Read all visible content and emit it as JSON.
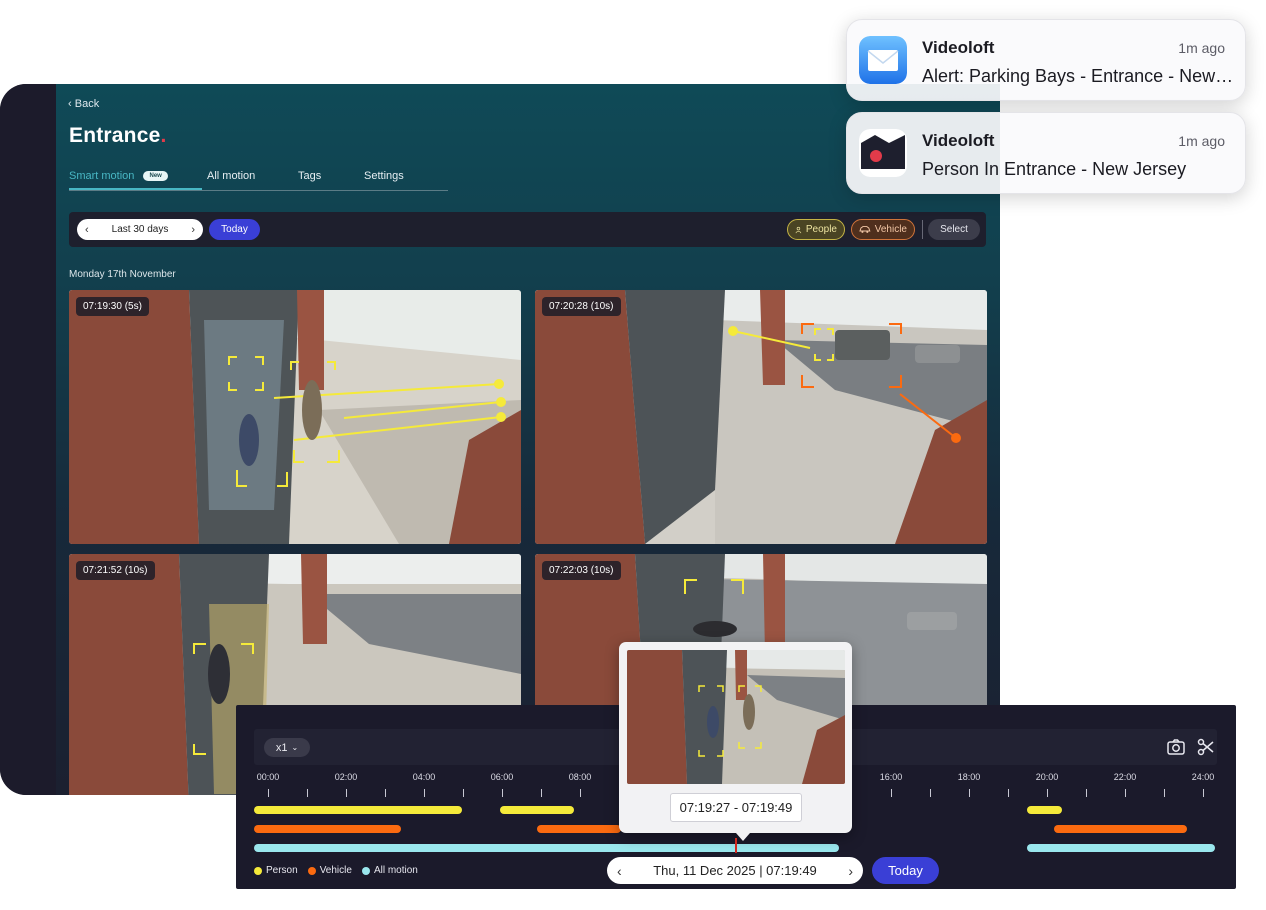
{
  "page": {
    "back_label": "Back",
    "title": "Entrance",
    "title_dot": "."
  },
  "tabs": [
    {
      "label": "Smart motion",
      "badge": "New",
      "active": true
    },
    {
      "label": "All motion"
    },
    {
      "label": "Tags"
    },
    {
      "label": "Settings"
    }
  ],
  "filters": {
    "range_label": "Last 30 days",
    "today_label": "Today",
    "people_label": "People",
    "vehicle_label": "Vehicle",
    "select_label": "Select"
  },
  "date_heading": "Monday 17th November",
  "clips": [
    {
      "timestamp": "07:19:30 (5s)"
    },
    {
      "timestamp": "07:20:28 (10s)"
    },
    {
      "timestamp": "07:21:52 (10s)"
    },
    {
      "timestamp": "07:22:03 (10s)"
    }
  ],
  "notifications": [
    {
      "app": "Videoloft",
      "time": "1m ago",
      "message": "Alert: Parking Bays - Entrance - New Jersey",
      "icon": "mail-icon"
    },
    {
      "app": "Videoloft",
      "time": "1m ago",
      "message": "Person In Entrance - New Jersey",
      "icon": "videoloft-logo-icon"
    }
  ],
  "timeline": {
    "speed": "x1",
    "hour_labels": [
      "00:00",
      "02:00",
      "04:00",
      "06:00",
      "08:00",
      "16:00",
      "18:00",
      "20:00",
      "22:00",
      "24:00"
    ],
    "legend": [
      {
        "label": "Person",
        "color": "#f5ea3a"
      },
      {
        "label": "Vehicle",
        "color": "#fb6a10"
      },
      {
        "label": "All motion",
        "color": "#9ae7ee"
      }
    ],
    "current_datetime": "Thu, 11 Dec 2025 | 07:19:49",
    "today_label": "Today",
    "preview_range": "07:19:27 - 07:19:49"
  },
  "colors": {
    "accent": "#3a3fd6",
    "person": "#f5ea3a",
    "vehicle": "#fb6a10",
    "motion": "#9ae7ee",
    "teal_tab": "#48b7c4"
  }
}
